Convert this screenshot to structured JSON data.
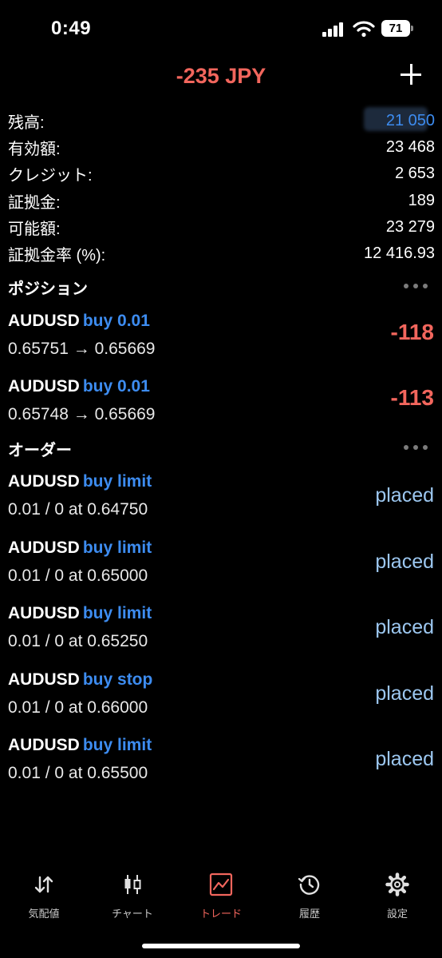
{
  "status": {
    "time": "0:49",
    "battery": "71"
  },
  "header": {
    "title": "-235 JPY"
  },
  "summary": [
    {
      "label": "残高:",
      "value": "21 050"
    },
    {
      "label": "有効額:",
      "value": "23 468"
    },
    {
      "label": "クレジット:",
      "value": "2 653"
    },
    {
      "label": "証拠金:",
      "value": "189"
    },
    {
      "label": "可能額:",
      "value": "23 279"
    },
    {
      "label": "証拠金率 (%):",
      "value": "12 416.93"
    }
  ],
  "positions": {
    "heading": "ポジション",
    "items": [
      {
        "symbol": "AUDUSD",
        "side": "buy 0.01",
        "prices": "0.65751 → 0.65669",
        "profit": "-118"
      },
      {
        "symbol": "AUDUSD",
        "side": "buy 0.01",
        "prices": "0.65748 → 0.65669",
        "profit": "-113"
      }
    ]
  },
  "orders": {
    "heading": "オーダー",
    "items": [
      {
        "symbol": "AUDUSD",
        "side": "buy limit",
        "detail": "0.01 / 0 at 0.64750",
        "state": "placed"
      },
      {
        "symbol": "AUDUSD",
        "side": "buy limit",
        "detail": "0.01 / 0 at 0.65000",
        "state": "placed"
      },
      {
        "symbol": "AUDUSD",
        "side": "buy limit",
        "detail": "0.01 / 0 at 0.65250",
        "state": "placed"
      },
      {
        "symbol": "AUDUSD",
        "side": "buy stop",
        "detail": "0.01 / 0 at 0.66000",
        "state": "placed"
      },
      {
        "symbol": "AUDUSD",
        "side": "buy limit",
        "detail": "0.01 / 0 at 0.65500",
        "state": "placed"
      }
    ]
  },
  "tabs": [
    {
      "label": "気配値",
      "icon": "quotes-icon"
    },
    {
      "label": "チャート",
      "icon": "chart-candles-icon"
    },
    {
      "label": "トレード",
      "icon": "trade-icon",
      "active": true
    },
    {
      "label": "履歴",
      "icon": "history-icon"
    },
    {
      "label": "設定",
      "icon": "settings-gear-icon"
    }
  ],
  "colors": {
    "loss": "#f2665d",
    "accent": "#3d8cf0",
    "state": "#9cc7f0",
    "background": "#000000"
  }
}
